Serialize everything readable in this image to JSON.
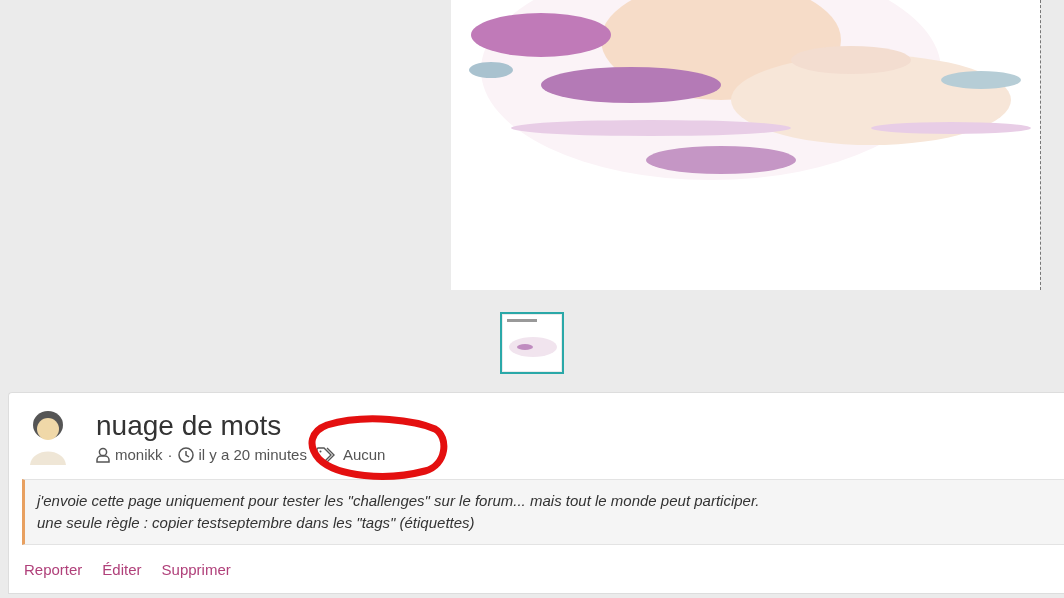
{
  "gallery": {
    "main_image": {
      "kind": "picture"
    },
    "thumbnails": [
      {
        "kind": "picture",
        "selected": true
      }
    ]
  },
  "post": {
    "title": "nuage de mots",
    "author": "monikk",
    "separator": "·",
    "time": "il y a 20 minutes",
    "tags": "Aucun",
    "annotation": {
      "kind": "ellipse"
    },
    "body": [
      "j'envoie cette page uniquement pour tester les \"challenges\" sur le forum... mais tout le monde peut participer.",
      "une seule règle : copier testseptembre dans les \"tags\" (étiquettes)"
    ],
    "actions": [
      "Reporter",
      "Éditer",
      "Supprimer"
    ]
  }
}
